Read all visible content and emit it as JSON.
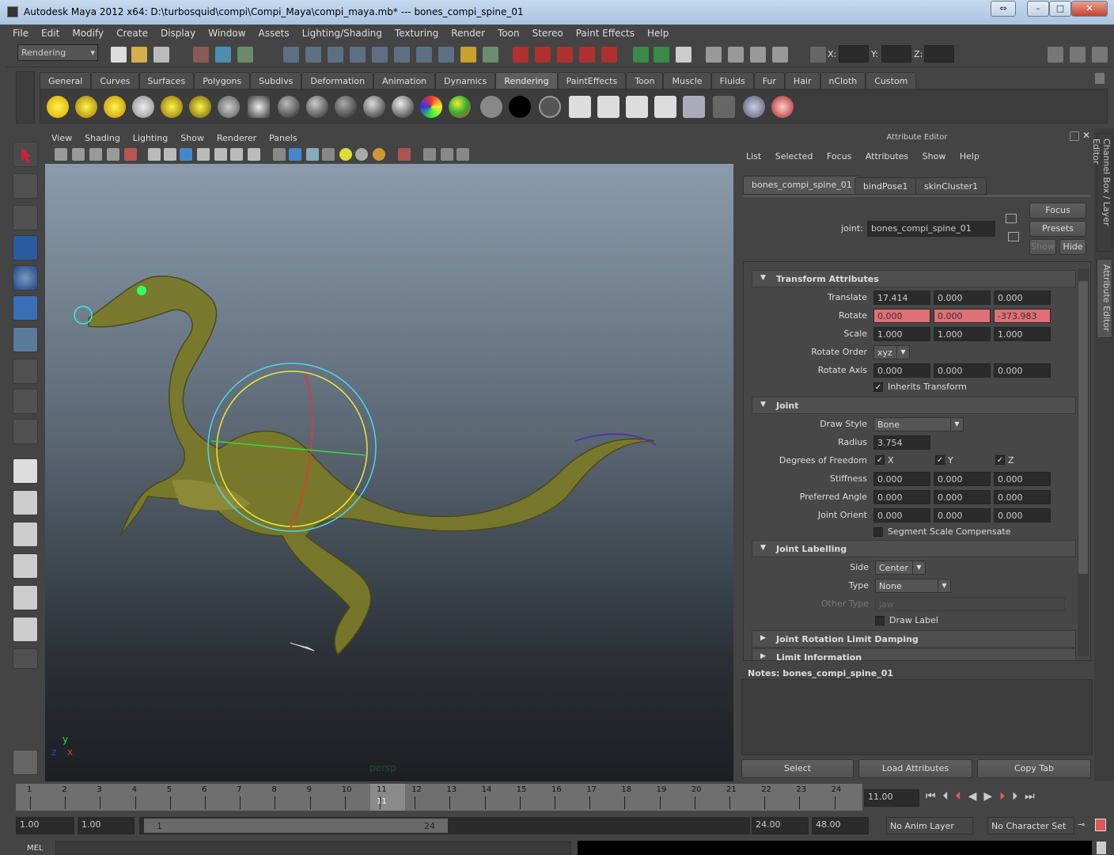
{
  "window": {
    "title": "Autodesk Maya 2012 x64: D:\\turbosquid\\compi\\Compi_Maya\\compi_maya.mb*   ---   bones_compi_spine_01",
    "minimize": "–",
    "maximize": "□",
    "close": "✕"
  },
  "menubar": [
    "File",
    "Edit",
    "Modify",
    "Create",
    "Display",
    "Window",
    "Assets",
    "Lighting/Shading",
    "Texturing",
    "Render",
    "Toon",
    "Stereo",
    "Paint Effects",
    "Help"
  ],
  "statusline": {
    "menu_set": "Rendering",
    "x_label": "X:",
    "y_label": "Y:",
    "z_label": "Z:"
  },
  "shelf": {
    "tabs": [
      "General",
      "Curves",
      "Surfaces",
      "Polygons",
      "Subdivs",
      "Deformation",
      "Animation",
      "Dynamics",
      "Rendering",
      "PaintEffects",
      "Toon",
      "Muscle",
      "Fluids",
      "Fur",
      "Hair",
      "nCloth",
      "Custom"
    ],
    "active": "Rendering"
  },
  "viewport": {
    "menu": [
      "View",
      "Shading",
      "Lighting",
      "Show",
      "Renderer",
      "Panels"
    ],
    "camera": "persp",
    "axis_y": "y",
    "axis_x": "x",
    "axis_z": "z"
  },
  "attribute_editor": {
    "title": "Attribute Editor",
    "menu": [
      "List",
      "Selected",
      "Focus",
      "Attributes",
      "Show",
      "Help"
    ],
    "tabs": [
      "bones_compi_spine_01",
      "bindPose1",
      "skinCluster1"
    ],
    "node_label": "joint:",
    "node_name": "bones_compi_spine_01",
    "buttons": {
      "focus": "Focus",
      "presets": "Presets",
      "show": "Show",
      "hide": "Hide"
    },
    "transform": {
      "header": "Transform Attributes",
      "translate_label": "Translate",
      "translate": [
        "17.414",
        "0.000",
        "0.000"
      ],
      "rotate_label": "Rotate",
      "rotate": [
        "0.000",
        "0.000",
        "-373.983"
      ],
      "scale_label": "Scale",
      "scale": [
        "1.000",
        "1.000",
        "1.000"
      ],
      "rotate_order_label": "Rotate Order",
      "rotate_order": "xyz",
      "rotate_axis_label": "Rotate Axis",
      "rotate_axis": [
        "0.000",
        "0.000",
        "0.000"
      ],
      "inherits_label": "Inherits Transform",
      "inherits": true
    },
    "joint": {
      "header": "Joint",
      "draw_style_label": "Draw Style",
      "draw_style": "Bone",
      "radius_label": "Radius",
      "radius": "3.754",
      "dof_label": "Degrees of Freedom",
      "dof": [
        "X",
        "Y",
        "Z"
      ],
      "stiffness_label": "Stiffness",
      "stiffness": [
        "0.000",
        "0.000",
        "0.000"
      ],
      "pref_angle_label": "Preferred Angle",
      "pref_angle": [
        "0.000",
        "0.000",
        "0.000"
      ],
      "orient_label": "Joint Orient",
      "orient": [
        "0.000",
        "0.000",
        "0.000"
      ],
      "ssc_label": "Segment Scale Compensate"
    },
    "labelling": {
      "header": "Joint Labelling",
      "side_label": "Side",
      "side": "Center",
      "type_label": "Type",
      "type": "None",
      "other_label": "Other Type",
      "other": "jaw",
      "draw_label": "Draw Label"
    },
    "collapsed": [
      "Joint Rotation Limit Damping",
      "Limit Information"
    ],
    "notes": "Notes:  bones_compi_spine_01",
    "bottom_buttons": [
      "Select",
      "Load Attributes",
      "Copy Tab"
    ]
  },
  "side_tabs": [
    "Channel Box / Layer Editor",
    "Attribute Editor"
  ],
  "timeline": {
    "frames": [
      "1",
      "2",
      "3",
      "4",
      "5",
      "6",
      "7",
      "8",
      "9",
      "10",
      "11",
      "12",
      "13",
      "14",
      "15",
      "16",
      "17",
      "18",
      "19",
      "20",
      "21",
      "22",
      "23",
      "24"
    ],
    "current": "11",
    "current_field": "11.00"
  },
  "range": {
    "start": "1.00",
    "inner_start": "1.00",
    "slider_start": "1",
    "slider_end": "24",
    "inner_end": "24.00",
    "end": "48.00",
    "anim_layer": "No Anim Layer",
    "character_set": "No Character Set"
  },
  "cmd": {
    "label": "MEL"
  }
}
